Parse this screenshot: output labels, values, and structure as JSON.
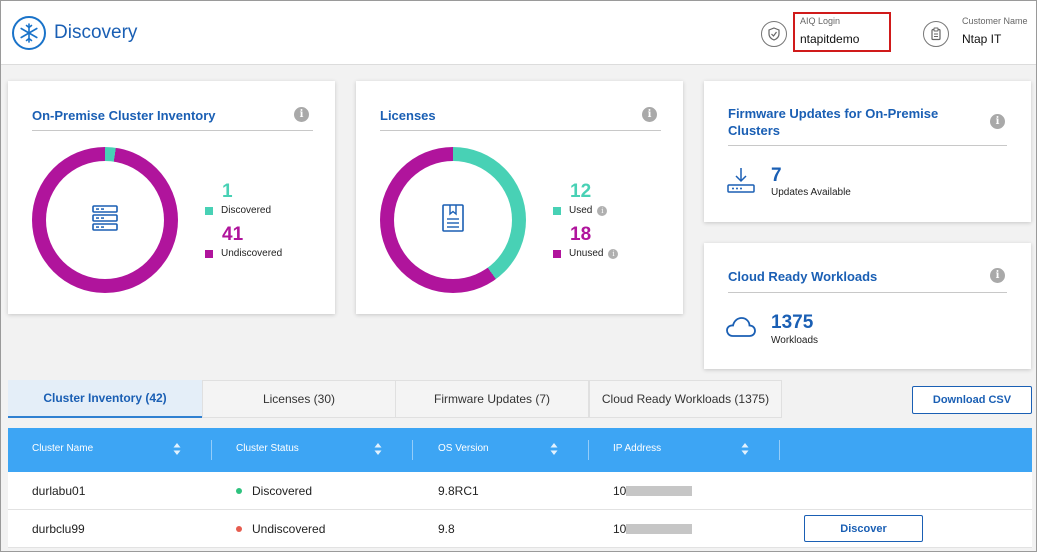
{
  "header": {
    "app_title": "Discovery",
    "aiq_login_label": "AIQ Login",
    "aiq_login_value": "ntapitdemo",
    "customer_name_label": "Customer Name",
    "customer_name_value": "Ntap IT",
    "icons": [
      "snowflake-icon",
      "shield-icon",
      "clipboard-icon"
    ]
  },
  "cards": {
    "inventory": {
      "title": "On-Premise Cluster Inventory",
      "discovered_count": "1",
      "discovered_label": "Discovered",
      "undiscovered_count": "41",
      "undiscovered_label": "Undiscovered",
      "discovered_fraction": 0.0238
    },
    "licenses": {
      "title": "Licenses",
      "used_count": "12",
      "used_label": "Used",
      "unused_count": "18",
      "unused_label": "Unused",
      "used_fraction": 0.4
    },
    "firmware": {
      "title": "Firmware Updates for On-Premise Clusters",
      "count": "7",
      "caption": "Updates Available"
    },
    "cloud": {
      "title": "Cloud Ready Workloads",
      "count": "1375",
      "caption": "Workloads"
    },
    "info_glyph": "i"
  },
  "colors": {
    "teal": "#48d1b5",
    "purple": "#b0149c",
    "accent": "#1a5fb4",
    "header_blue": "#3da5f4",
    "discovered_dot": "#2ec27e",
    "undiscovered_dot": "#e65c4f"
  },
  "tabs": [
    {
      "label": "Cluster Inventory (42)",
      "active": true
    },
    {
      "label": "Licenses (30)",
      "active": false
    },
    {
      "label": "Firmware Updates (7)",
      "active": false
    },
    {
      "label": "Cloud Ready Workloads (1375)",
      "active": false
    }
  ],
  "download_csv_label": "Download CSV",
  "table": {
    "columns": [
      "Cluster Name",
      "Cluster Status",
      "OS Version",
      "IP Address"
    ],
    "rows": [
      {
        "name": "durlabu01",
        "status": "Discovered",
        "os": "9.8RC1",
        "ip": "10.",
        "action": ""
      },
      {
        "name": "durbclu99",
        "status": "Undiscovered",
        "os": "9.8",
        "ip": "10.",
        "action": "Discover"
      }
    ]
  }
}
